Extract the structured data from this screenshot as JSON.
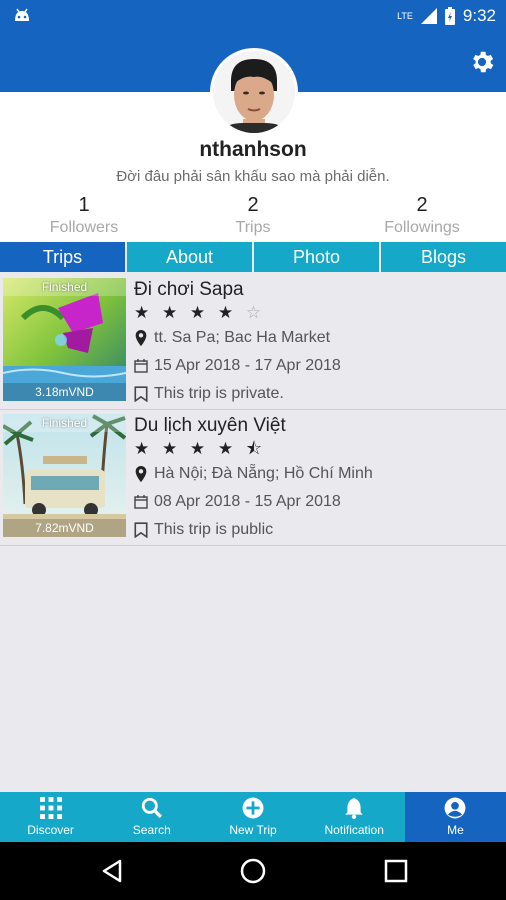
{
  "status": {
    "time": "9:32",
    "network": "LTE"
  },
  "profile": {
    "username": "nthanhson",
    "bio": "Đời đâu phải sân khấu sao mà phải diễn.",
    "stats": [
      {
        "value": "1",
        "label": "Followers"
      },
      {
        "value": "2",
        "label": "Trips"
      },
      {
        "value": "2",
        "label": "Followings"
      }
    ]
  },
  "tabs": [
    "Trips",
    "About",
    "Photo",
    "Blogs"
  ],
  "trips": [
    {
      "status": "Finished",
      "cost": "3.18mVND",
      "name": "Đi chơi Sapa",
      "rating": 4,
      "stars_full": "★ ★ ★ ★",
      "stars_empty": "☆",
      "places": "tt. Sa Pa; Bac Ha Market",
      "dates": "15 Apr 2018 -  17 Apr 2018",
      "privacy": "This trip is private."
    },
    {
      "status": "Finished",
      "cost": "7.82mVND",
      "name": "Du lịch xuyên Việt",
      "rating": 4.5,
      "stars_full": "★ ★ ★ ★",
      "stars_empty": "⯪",
      "places": "Hà Nội; Đà Nẵng; Hồ Chí Minh",
      "dates": "08 Apr 2018 -  15 Apr 2018",
      "privacy": "This trip is public"
    }
  ],
  "bottom_nav": [
    {
      "label": "Discover",
      "icon": "grid-icon"
    },
    {
      "label": "Search",
      "icon": "search-icon"
    },
    {
      "label": "New Trip",
      "icon": "add-circle-icon"
    },
    {
      "label": "Notification",
      "icon": "bell-icon"
    },
    {
      "label": "Me",
      "icon": "person-icon"
    }
  ],
  "colors": {
    "primary": "#1565c0",
    "accent": "#15a8c8",
    "background": "#e9e9ee"
  }
}
